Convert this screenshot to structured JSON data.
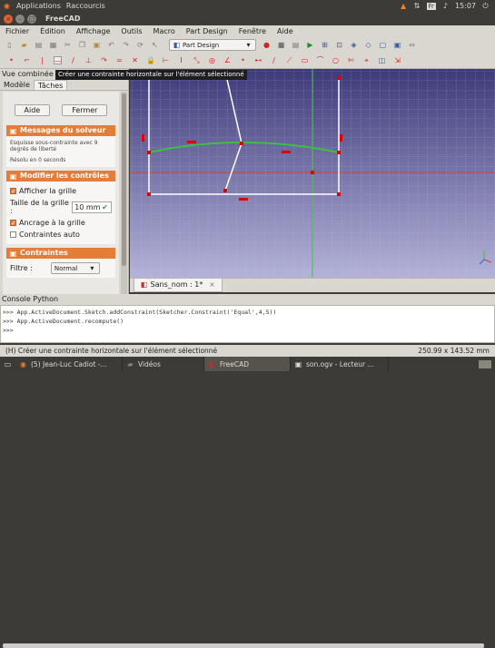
{
  "topbar": {
    "apps": "Applications",
    "shortcuts": "Raccourcis",
    "time": "15:07",
    "keyboard": "Fr"
  },
  "window": {
    "title": "FreeCAD"
  },
  "menu": [
    "Fichier",
    "Édition",
    "Affichage",
    "Outils",
    "Macro",
    "Part Design",
    "Fenêtre",
    "Aide"
  ],
  "toolbar": {
    "workbench": "Part Design"
  },
  "tooltip": "Créer une contrainte horizontale sur l'élément sélectionné",
  "left_panel": {
    "title": "Vue combinée",
    "tabs": [
      "Modèle",
      "Tâches"
    ],
    "aide": "Aide",
    "fermer": "Fermer",
    "solver": {
      "title": "Messages du solveur",
      "line1": "Esquisse sous-contrainte avec 9 degrés de liberté",
      "line2": "Résolu en 0 seconds"
    },
    "controls": {
      "title": "Modifier les contrôles",
      "show_grid": "Afficher la grille",
      "grid_size_label": "Taille de la grille :",
      "grid_size_value": "10 mm",
      "snap": "Ancrage à la grille",
      "auto": "Contraintes auto"
    },
    "constraints": {
      "title": "Contraintes",
      "filter_label": "Filtre :",
      "filter_value": "Normal"
    }
  },
  "doc_tab": "Sans_nom : 1*",
  "console": {
    "title": "Console Python",
    "lines": [
      ">>> App.ActiveDocument.Sketch.addConstraint(Sketcher.Constraint('Equal',4,5))",
      ">>> App.ActiveDocument.recompute()",
      ">>>"
    ]
  },
  "status": {
    "text": "(H) Créer une contrainte horizontale sur l'élément sélectionné",
    "size": "250.99 x 143.52 mm"
  },
  "taskbar": [
    "(5) Jean-Luc Cadiot -...",
    "Vidéos",
    "FreeCAD",
    "son.ogv - Lecteur ..."
  ],
  "colors": {
    "accent": "#e47d3a",
    "viewport": "#7a78b2",
    "sketch_green": "#3fbf3f",
    "sketch_white": "#ffffff"
  }
}
